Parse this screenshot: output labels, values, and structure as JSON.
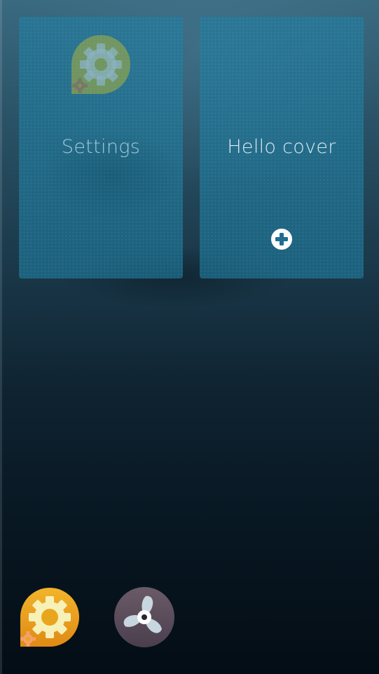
{
  "covers": [
    {
      "title": "Settings",
      "icon": "settings-gear-icon"
    },
    {
      "title": "Hello cover",
      "action_icon": "plus-circle-icon"
    }
  ],
  "launcher": [
    {
      "icon": "settings-gear-icon",
      "color": "#e8a21c"
    },
    {
      "icon": "propeller-fan-icon",
      "color": "#5a4d5c"
    }
  ],
  "colors": {
    "cover_bg": "#1e7da0",
    "background_top": "#3a6a80",
    "background_bottom": "#040d15"
  }
}
